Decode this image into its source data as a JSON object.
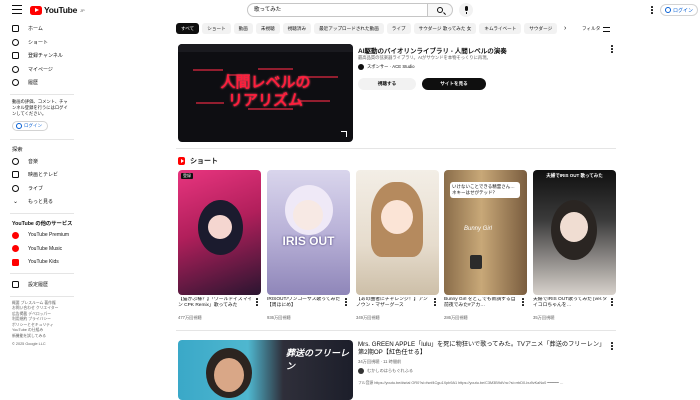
{
  "header": {
    "logo_text": "YouTube",
    "region": "JP",
    "search_value": "歌ってみた",
    "login_label": "ログイン"
  },
  "sidebar": {
    "items": [
      {
        "label": "ホーム",
        "icon": "home-icon"
      },
      {
        "label": "ショート",
        "icon": "shorts-icon"
      },
      {
        "label": "登録チャンネル",
        "icon": "subscriptions-icon"
      },
      {
        "label": "マイページ",
        "icon": "you-icon"
      },
      {
        "label": "履歴",
        "icon": "history-icon"
      }
    ],
    "note": "動画の評価、コメント、チャンネル登録を行うにはログインしてください。",
    "login_label": "ログイン",
    "explore_title": "探索",
    "explore_items": [
      {
        "label": "音楽",
        "icon": "music-icon"
      },
      {
        "label": "映画とテレビ",
        "icon": "movie-icon"
      },
      {
        "label": "ライブ",
        "icon": "live-icon"
      },
      {
        "label": "もっと見る",
        "icon": "chevron-down-icon"
      }
    ],
    "services_title": "YouTube の他のサービス",
    "services": [
      {
        "label": "YouTube Premium"
      },
      {
        "label": "YouTube Music"
      },
      {
        "label": "YouTube Kids"
      }
    ],
    "settings_label": "設定履歴",
    "footer_lines": [
      "概要  プレスルーム  著作権",
      "お問い合わせ  クリエイター",
      "広告掲載  デベロッパー",
      "利用規約  プライバシー",
      "ポリシーとセキュリティ",
      "YouTube の仕組み",
      "新機能を試してみる",
      "© 2025 Google LLC"
    ]
  },
  "chips": [
    "すべて",
    "ショート",
    "動画",
    "未視聴",
    "視聴済み",
    "最近アップロードされた動画",
    "ライブ",
    "サウダージ 歌ってみた 女",
    "キムライベート",
    "サウダージ"
  ],
  "filter_label": "フィルタ",
  "ad": {
    "thumb_text": "人間レベルの\nリアリズム",
    "title": "AI駆動のバイオリンライブラリ - 人間レベルの演奏",
    "desc": "最高品質の弦楽器ライブラリ。AIがサウンドを本物そっくりに再現。",
    "sponsor": "スポンサー · ACE Studio",
    "btn_watch": "視聴する",
    "btn_site": "サイトを見る"
  },
  "shorts": {
    "title": "ショート",
    "items": [
      {
        "title": "【猫かぶ様？】「ワールドイズマイン CPK Remix」歌ってみた",
        "views": "477万回視聴",
        "badge": "登録"
      },
      {
        "title": "IRISOUT/ワンコーサス歌ってみた【周ほにめ】",
        "views": "936万回視聴",
        "overlay": "IRIS OUT"
      },
      {
        "title": "【あの曲者にチャレンジ！】アンノウン・マザーグース",
        "views": "349万回視聴"
      },
      {
        "title": "Bunny Girl をどこでも新調する自前夜でみた#アカ…",
        "views": "286万回視聴",
        "overlay": "いけないことできる精霊さん…ネキーはせがテッド？",
        "label": "Bunny Girl"
      },
      {
        "title": "夫婦でIRIS OUT歌ってみた [ver.タイコロちゃんを…",
        "views": "35万回視聴",
        "overlay": "夫婦でIRIS OUT 歌ってみた"
      }
    ]
  },
  "video": {
    "title": "Mrs. GREEN APPLE「lulu」を死に物狂いで歌ってみた。TVアニメ「葬送のフリーレン」第2期OP【紅色任せる】",
    "meta": "34万回視聴 · 11 時間前",
    "channel": "むかしのはらもぐれふる",
    "desc": "フル音源 https://youtu.be/dsrial OR0?si=fsnf4Cgu1Xpb9A1 https://youtu.be/C3M3B9dVnc?si=rrbD0-bu9vKaNo0 ━━━━━ …",
    "thumb_text": "葬送のフリーレン"
  },
  "colors": {
    "accent": "#ff0000",
    "link": "#065fd4",
    "chip_bg": "#f2f2f2"
  }
}
